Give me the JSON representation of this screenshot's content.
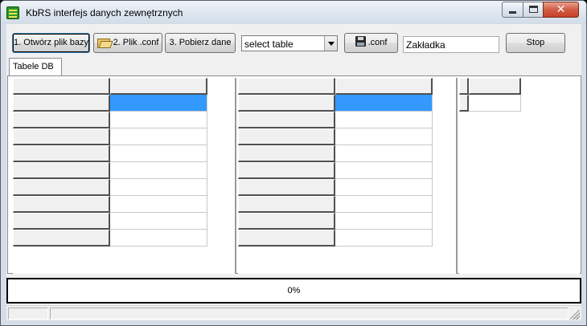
{
  "window": {
    "title": "KbRS interfejs danych zewnętrznych",
    "caption_close": "✕"
  },
  "toolbar": {
    "open_db_label": "1. Otwórz plik bazy",
    "conf_file_label": "2. Plik .conf",
    "fetch_data_label": "3. Pobierz dane",
    "table_select_value": "select table",
    "save_conf_label": ".conf",
    "bookmark_value": "Zakładka",
    "stop_label": "Stop"
  },
  "tabs": [
    {
      "label": "Tabele DB"
    }
  ],
  "grids": {
    "grid1": {
      "rows": 10,
      "selected_row": 1
    },
    "grid2": {
      "rows": 10,
      "selected_row": 1
    },
    "grid3": {
      "rows": 2,
      "selected_row": null
    }
  },
  "progress": {
    "value": 0,
    "text": "0%"
  },
  "colors": {
    "selection": "#3399ff",
    "close_button": "#c8412a"
  },
  "icons": [
    "app-icon",
    "folder-open-icon",
    "floppy-disk-icon",
    "dropdown-arrow-icon",
    "size-grip-icon"
  ]
}
